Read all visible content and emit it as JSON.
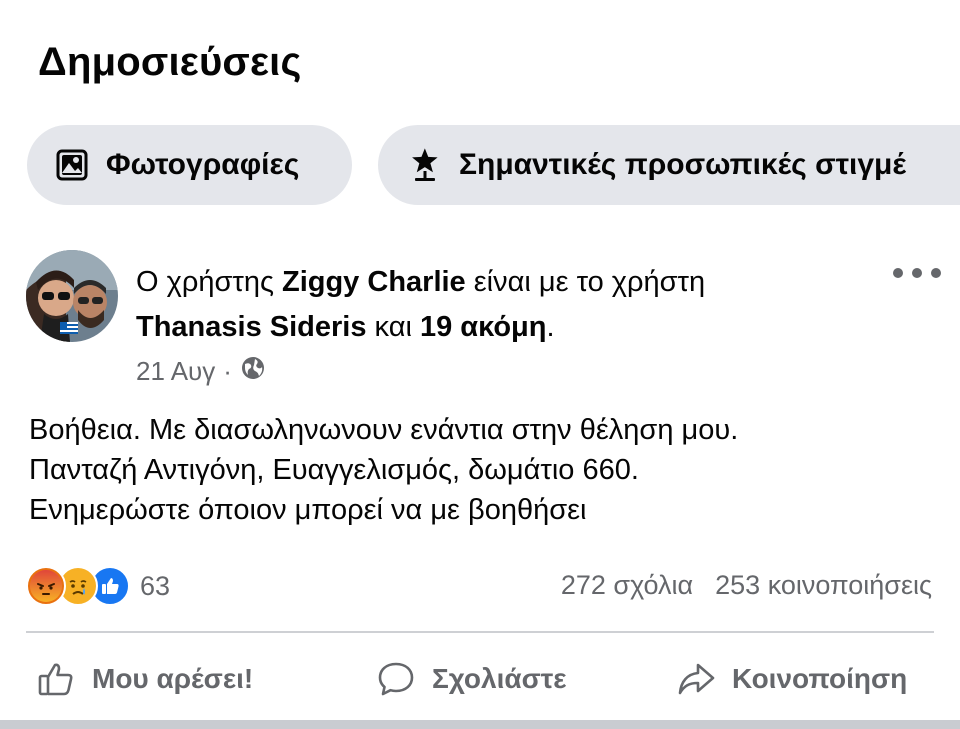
{
  "section": {
    "title": "Δημοσιεύσεις"
  },
  "chips": {
    "photos": {
      "label": "Φωτογραφίες",
      "icon": "photos-icon"
    },
    "highlights": {
      "label": "Σημαντικές προσωπικές στιγμέ",
      "icon": "star-pin-icon"
    }
  },
  "post": {
    "header": {
      "prefix": "Ο χρήστης ",
      "author": "Ziggy Charlie",
      "with_text": " είναι με το χρήστη",
      "tagged": "Thanasis Sideris",
      "and_text": " και ",
      "others": "19 ακόμη",
      "end": "."
    },
    "date": "21 Αυγ",
    "separator": "·",
    "privacy_icon": "globe-icon",
    "body": [
      "Βοήθεια. Με διασωληνωνουν ενάντια στην θέληση μου.",
      "Πανταζή Αντιγόνη, Ευαγγελισμός, δωμάτιο 660.",
      "Ενημερώστε όποιον μπορεί να με βοηθήσει"
    ],
    "reactions": {
      "icons": [
        "angry-reaction-icon",
        "sad-reaction-icon",
        "like-reaction-icon"
      ],
      "count": "63"
    },
    "comments": "272 σχόλια",
    "shares": "253 κοινοποιήσεις"
  },
  "actions": {
    "like": "Μου αρέσει!",
    "comment": "Σχολιάστε",
    "share": "Κοινοποίηση"
  },
  "colors": {
    "chip_bg": "#e4e6eb",
    "secondary_text": "#65676b",
    "like_blue": "#1877f2",
    "angry": "#e9710f",
    "sad": "#f7b125"
  }
}
